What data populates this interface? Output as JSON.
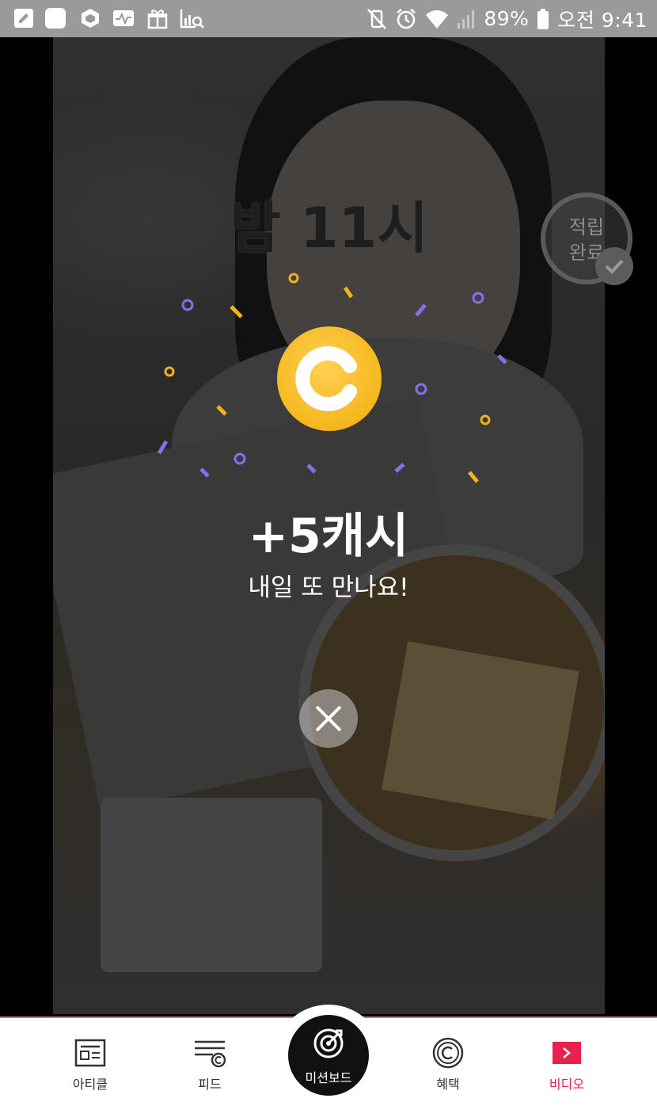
{
  "status_bar": {
    "battery": "89%",
    "time": "오전 9:41"
  },
  "video": {
    "caption": "밤 11시"
  },
  "earned_badge": {
    "label": "적립\n완료"
  },
  "reward": {
    "amount": "+5캐시",
    "message": "내일 또 만나요!"
  },
  "bottom_nav": {
    "items": [
      {
        "label": "아티클",
        "icon": "article-icon"
      },
      {
        "label": "피드",
        "icon": "feed-icon"
      },
      {
        "label": "미션보드",
        "icon": "target-icon"
      },
      {
        "label": "혜택",
        "icon": "cash-coin-icon"
      },
      {
        "label": "비디오",
        "icon": "video-play-icon"
      }
    ],
    "active_index": 4
  },
  "colors": {
    "accent": "#e8224d",
    "coin": "#f5b71d",
    "confetti_purple": "#8a6cf0",
    "confetti_yellow": "#f2b21a"
  }
}
